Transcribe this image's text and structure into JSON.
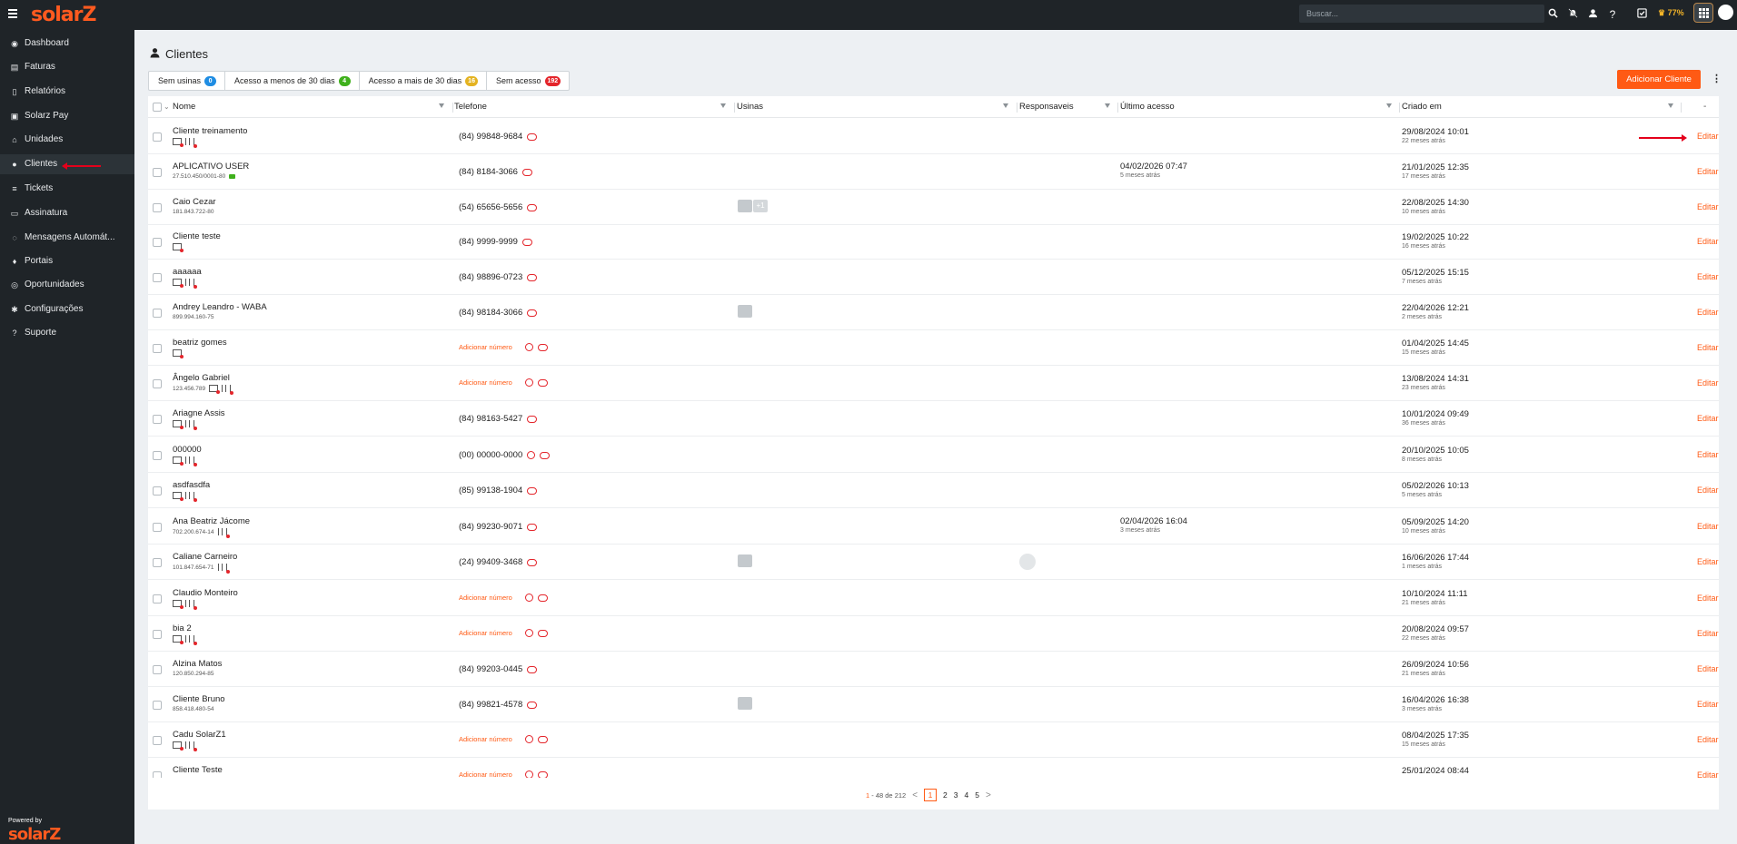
{
  "app": {
    "logo": "solarZ",
    "powered_by": "Powered by",
    "footer_logo": "solarZ"
  },
  "topbar": {
    "search_placeholder": "Buscar...",
    "battery": "77%",
    "icons": [
      "search-icon",
      "bell-off-icon",
      "chat-icon",
      "help-icon",
      "checklist-icon",
      "apps-icon",
      "user-avatar"
    ]
  },
  "sidebar": {
    "items": [
      {
        "label": "Dashboard",
        "icon": "dashboard-icon"
      },
      {
        "label": "Faturas",
        "icon": "invoice-icon"
      },
      {
        "label": "Relatórios",
        "icon": "report-icon"
      },
      {
        "label": "Solarz Pay",
        "icon": "pay-icon"
      },
      {
        "label": "Unidades",
        "icon": "home-icon"
      },
      {
        "label": "Clientes",
        "icon": "user-icon",
        "active": true
      },
      {
        "label": "Tickets",
        "icon": "ticket-icon"
      },
      {
        "label": "Assinatura",
        "icon": "subscription-icon"
      },
      {
        "label": "Mensagens Automát...",
        "icon": "message-icon"
      },
      {
        "label": "Portais",
        "icon": "portal-icon"
      },
      {
        "label": "Oportunidades",
        "icon": "opportunity-icon"
      },
      {
        "label": "Configurações",
        "icon": "gear-icon"
      },
      {
        "label": "Suporte",
        "icon": "help-icon"
      }
    ]
  },
  "page": {
    "title": "Clientes",
    "add_button": "Adicionar Cliente",
    "more_menu": "⋮",
    "filters": [
      {
        "label": "Sem usinas",
        "count": "0",
        "color": "#1f8de3"
      },
      {
        "label": "Acesso a menos de 30 dias",
        "count": "4",
        "color": "#3fb01c"
      },
      {
        "label": "Acesso a mais de 30 dias",
        "count": "16",
        "color": "#e4b321"
      },
      {
        "label": "Sem acesso",
        "count": "192",
        "color": "#e4252b"
      }
    ]
  },
  "table": {
    "columns": [
      "Nome",
      "Telefone",
      "Usinas",
      "Responsaveis",
      "Último acesso",
      "Criado em",
      "-"
    ],
    "edit_label": "Editar",
    "rows": [
      {
        "name": "Cliente treinamento",
        "sub": "",
        "icons": [
          "card",
          "map"
        ],
        "phone": "(84) 99848-9684",
        "wa": false,
        "usinas": 0,
        "plus": "",
        "resp": false,
        "last": "",
        "last_ago": "",
        "created": "29/08/2024 10:01",
        "created_ago": "22 meses atrás"
      },
      {
        "name": "APLICATIVO USER",
        "sub": "27.510.450/0001-80",
        "icons": [
          "green"
        ],
        "phone": "(84) 8184-3066",
        "wa": false,
        "usinas": 0,
        "plus": "",
        "resp": false,
        "last": "04/02/2026 07:47",
        "last_ago": "5 meses atrás",
        "created": "21/01/2025 12:35",
        "created_ago": "17 meses atrás"
      },
      {
        "name": "Caio Cezar",
        "sub": "181.843.722-80",
        "icons": [],
        "phone": "(54) 65656-5656",
        "wa": false,
        "usinas": 1,
        "plus": "+1",
        "resp": false,
        "last": "",
        "last_ago": "",
        "created": "22/08/2025 14:30",
        "created_ago": "10 meses atrás"
      },
      {
        "name": "Cliente teste",
        "sub": "",
        "icons": [
          "card"
        ],
        "phone": "(84) 9999-9999",
        "wa": false,
        "usinas": 0,
        "plus": "",
        "resp": false,
        "last": "",
        "last_ago": "",
        "created": "19/02/2025 10:22",
        "created_ago": "16 meses atrás"
      },
      {
        "name": "aaaaaa",
        "sub": "",
        "icons": [
          "card",
          "map"
        ],
        "phone": "(84) 98896-0723",
        "wa": false,
        "usinas": 0,
        "plus": "",
        "resp": false,
        "last": "",
        "last_ago": "",
        "created": "05/12/2025 15:15",
        "created_ago": "7 meses atrás"
      },
      {
        "name": "Andrey Leandro - WABA",
        "sub": "899.994.160-75",
        "icons": [],
        "phone": "(84) 98184-3066",
        "wa": false,
        "usinas": 1,
        "plus": "",
        "resp": false,
        "last": "",
        "last_ago": "",
        "created": "22/04/2026 12:21",
        "created_ago": "2 meses atrás"
      },
      {
        "name": "beatriz gomes",
        "sub": "",
        "icons": [
          "card"
        ],
        "phone": "Adicionar número",
        "wa": true,
        "usinas": 0,
        "plus": "",
        "resp": false,
        "last": "",
        "last_ago": "",
        "created": "01/04/2025 14:45",
        "created_ago": "15 meses atrás"
      },
      {
        "name": "Ângelo Gabriel",
        "sub": "123.456.789",
        "icons": [
          "card",
          "map"
        ],
        "phone": "Adicionar número",
        "wa": true,
        "usinas": 0,
        "plus": "",
        "resp": false,
        "last": "",
        "last_ago": "",
        "created": "13/08/2024 14:31",
        "created_ago": "23 meses atrás"
      },
      {
        "name": "Ariagne Assis",
        "sub": "",
        "icons": [
          "card",
          "map"
        ],
        "phone": "(84) 98163-5427",
        "wa": false,
        "usinas": 0,
        "plus": "",
        "resp": false,
        "last": "",
        "last_ago": "",
        "created": "10/01/2024 09:49",
        "created_ago": "36 meses atrás"
      },
      {
        "name": "000000",
        "sub": "",
        "icons": [
          "card",
          "map"
        ],
        "phone": "(00) 00000-0000",
        "wa": true,
        "usinas": 0,
        "plus": "",
        "resp": false,
        "last": "",
        "last_ago": "",
        "created": "20/10/2025 10:05",
        "created_ago": "8 meses atrás"
      },
      {
        "name": "asdfasdfa",
        "sub": "",
        "icons": [
          "card",
          "map"
        ],
        "phone": "(85) 99138-1904",
        "wa": false,
        "usinas": 0,
        "plus": "",
        "resp": false,
        "last": "",
        "last_ago": "",
        "created": "05/02/2026 10:13",
        "created_ago": "5 meses atrás"
      },
      {
        "name": "Ana Beatriz Jácome",
        "sub": "702.200.674-14",
        "icons": [
          "map"
        ],
        "phone": "(84) 99230-9071",
        "wa": false,
        "usinas": 0,
        "plus": "",
        "resp": false,
        "last": "02/04/2026 16:04",
        "last_ago": "3 meses atrás",
        "created": "05/09/2025 14:20",
        "created_ago": "10 meses atrás"
      },
      {
        "name": "Caliane Carneiro",
        "sub": "101.847.654-71",
        "icons": [
          "map"
        ],
        "phone": "(24) 99409-3468",
        "wa": false,
        "usinas": 1,
        "plus": "",
        "resp": true,
        "last": "",
        "last_ago": "",
        "created": "16/06/2026 17:44",
        "created_ago": "1 meses atrás"
      },
      {
        "name": "Claudio Monteiro",
        "sub": "",
        "icons": [
          "card",
          "map"
        ],
        "phone": "Adicionar número",
        "wa": true,
        "usinas": 0,
        "plus": "",
        "resp": false,
        "last": "",
        "last_ago": "",
        "created": "10/10/2024 11:11",
        "created_ago": "21 meses atrás"
      },
      {
        "name": "bia 2",
        "sub": "",
        "icons": [
          "card",
          "map"
        ],
        "phone": "Adicionar número",
        "wa": true,
        "usinas": 0,
        "plus": "",
        "resp": false,
        "last": "",
        "last_ago": "",
        "created": "20/08/2024 09:57",
        "created_ago": "22 meses atrás"
      },
      {
        "name": "Alzina Matos",
        "sub": "120.850.294-85",
        "icons": [],
        "phone": "(84) 99203-0445",
        "wa": false,
        "usinas": 0,
        "plus": "",
        "resp": false,
        "last": "",
        "last_ago": "",
        "created": "26/09/2024 10:56",
        "created_ago": "21 meses atrás"
      },
      {
        "name": "Cliente Bruno",
        "sub": "858.418.480-54",
        "icons": [],
        "phone": "(84) 99821-4578",
        "wa": false,
        "usinas": 1,
        "plus": "",
        "resp": false,
        "last": "",
        "last_ago": "",
        "created": "16/04/2026 16:38",
        "created_ago": "3 meses atrás"
      },
      {
        "name": "Cadu SolarZ1",
        "sub": "",
        "icons": [
          "card",
          "map"
        ],
        "phone": "Adicionar número",
        "wa": true,
        "usinas": 0,
        "plus": "",
        "resp": false,
        "last": "",
        "last_ago": "",
        "created": "08/04/2025 17:35",
        "created_ago": "15 meses atrás"
      },
      {
        "name": "Cliente Teste",
        "sub": "",
        "icons": [],
        "phone": "Adicionar número",
        "wa": true,
        "usinas": 0,
        "plus": "",
        "resp": false,
        "last": "",
        "last_ago": "",
        "created": "25/01/2024 08:44",
        "created_ago": ""
      }
    ]
  },
  "pagination": {
    "range_start": "1",
    "range_rest": " - 48 de 212",
    "prev": "<",
    "next": ">",
    "pages": [
      "1",
      "2",
      "3",
      "4",
      "5"
    ],
    "current": "1"
  }
}
